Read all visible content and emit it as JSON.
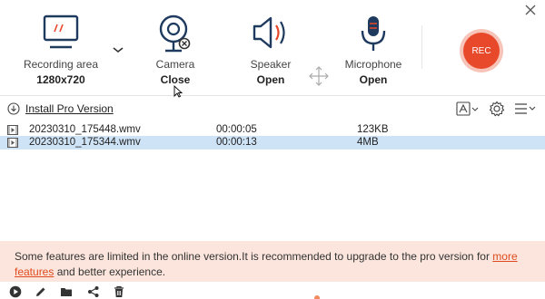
{
  "window": {
    "close_icon": "close-icon"
  },
  "toolbar": {
    "recording_area": {
      "label": "Recording area",
      "value": "1280x720",
      "icon": "monitor-icon"
    },
    "camera": {
      "label": "Camera",
      "value": "Close",
      "icon": "webcam-icon"
    },
    "speaker": {
      "label": "Speaker",
      "value": "Open",
      "icon": "speaker-icon"
    },
    "microphone": {
      "label": "Microphone",
      "value": "Open",
      "icon": "microphone-icon"
    },
    "rec_label": "REC",
    "rec_color": "#e8492b",
    "accent_color": "#1f3a5f"
  },
  "subbar": {
    "install_label": "Install Pro Version",
    "icons": [
      "text-format-icon",
      "gear-icon",
      "menu-icon"
    ]
  },
  "files": [
    {
      "name": "20230310_175448.wmv",
      "duration": "00:00:05",
      "size": "123KB",
      "selected": false
    },
    {
      "name": "20230310_175344.wmv",
      "duration": "00:00:13",
      "size": "4MB",
      "selected": true
    }
  ],
  "notice": {
    "text_before": "Some features are limited in the online version.It is recommended to upgrade to the pro version for ",
    "link": "more features",
    "text_after": " and better experience.",
    "background": "#fbe5dc",
    "link_color": "#e04a1e"
  },
  "bottombar": {
    "icons": [
      "play-icon",
      "edit-icon",
      "folder-icon",
      "share-icon",
      "trash-icon"
    ]
  }
}
